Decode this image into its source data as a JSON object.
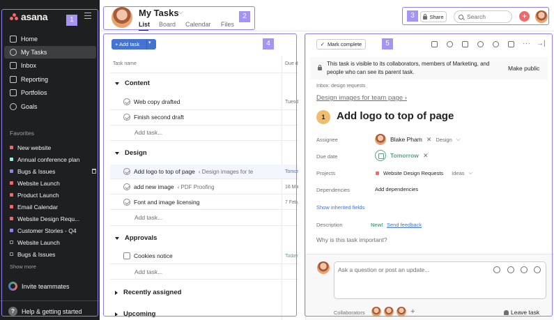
{
  "sidebar": {
    "logo_text": "asana",
    "nav": [
      {
        "label": "Home",
        "icon": "home-icon"
      },
      {
        "label": "My Tasks",
        "icon": "check-circle-icon",
        "active": true
      },
      {
        "label": "Inbox",
        "icon": "bell-icon"
      },
      {
        "label": "Reporting",
        "icon": "chart-line-icon"
      },
      {
        "label": "Portfolios",
        "icon": "portfolio-icon"
      },
      {
        "label": "Goals",
        "icon": "person-icon"
      }
    ],
    "favorites_title": "Favorites",
    "favorites": [
      {
        "label": "New website",
        "color": "#f06a6a",
        "icon": "bar-chart-icon"
      },
      {
        "label": "Annual conference plan",
        "color": "#9ee7e3"
      },
      {
        "label": "Bugs & Issues",
        "color": "#8d84e8"
      },
      {
        "label": "Website Launch",
        "color": "#f06a6a"
      },
      {
        "label": "Product Launch",
        "color": "#f06a6a"
      },
      {
        "label": "Email Calendar",
        "color": "#f06a6a"
      },
      {
        "label": "Website Design Requ...",
        "color": "#f06a6a"
      },
      {
        "label": "Customer Stories - Q4",
        "color": "#8d84e8"
      },
      {
        "label": "Website Launch",
        "color": "#9ca0a8",
        "icon": "template-icon"
      },
      {
        "label": "Bugs & Issues",
        "color": "#9ca0a8",
        "icon": "template-icon"
      }
    ],
    "show_more": "Show more",
    "invite": "Invite teammates",
    "help": "Help & getting started"
  },
  "header": {
    "title": "My Tasks",
    "tabs": [
      "List",
      "Board",
      "Calendar",
      "Files"
    ],
    "share": "Share",
    "search_placeholder": "Search"
  },
  "list": {
    "add_task": "+ Add task",
    "col_name": "Task name",
    "col_due": "Due date",
    "sections": [
      {
        "name": "Content",
        "tasks": [
          {
            "name": "Web copy drafted",
            "project": "",
            "due": "Tuesday"
          },
          {
            "name": "Finish second draft",
            "project": "",
            "due": ""
          }
        ]
      },
      {
        "name": "Design",
        "tasks": [
          {
            "name": "Add logo to top of page",
            "project": "‹ Design images for te",
            "due": "Tomorrow"
          },
          {
            "name": "add new image",
            "project": "‹ PDF Proofing",
            "due": "16 Mar, 2"
          },
          {
            "name": "Font and image licensing",
            "project": "",
            "due": "7 Feb, 22"
          }
        ]
      },
      {
        "name": "Approvals",
        "tasks": [
          {
            "name": "Cookies notice",
            "project": "",
            "due": "Today"
          }
        ]
      },
      {
        "name": "Recently assigned",
        "tasks": []
      },
      {
        "name": "Upcoming",
        "tasks": []
      }
    ],
    "add_task_link": "Add task..."
  },
  "detail": {
    "mark_complete": "Mark complete",
    "notice": "This task is visible to its collaborators, members of Marketing, and people who can see its parent task.",
    "make_public": "Make public",
    "inbox_label": "Inbox: design requests",
    "parent_task": "Design images for team page ›",
    "number": "1",
    "title": "Add logo to top of page",
    "assignee_label": "Assignee",
    "assignee": "Blake Pham",
    "assignee_tag": "Design",
    "due_label": "Due date",
    "due": "Tomorrow",
    "projects_label": "Projects",
    "project": "Website Design Requests",
    "project_section": "Ideas",
    "dependencies_label": "Dependencies",
    "add_dependencies": "Add dependencies",
    "show_inherited": "Show inherited fields",
    "description_label": "Description",
    "new_badge": "New!",
    "send_feedback": "Send feedback",
    "description_placeholder": "Why is this task important?",
    "comment_placeholder": "Ask a question or post an update...",
    "collaborators_label": "Collaborators",
    "leave_task": "Leave task"
  },
  "regions": [
    "1",
    "2",
    "3",
    "4",
    "5"
  ]
}
